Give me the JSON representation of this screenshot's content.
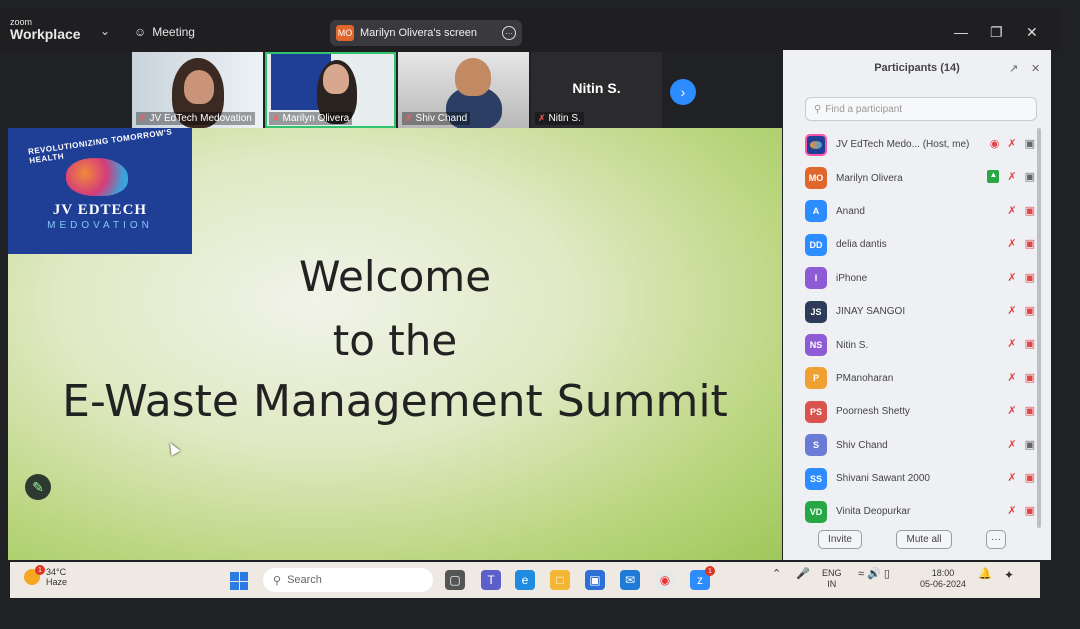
{
  "app": {
    "logo_small": "zoom",
    "logo_big": "Workplace",
    "meeting_label": "Meeting"
  },
  "share_pill": {
    "avatar": "MO",
    "label": "Marilyn Olivera's screen"
  },
  "thumbnails": [
    {
      "name": "JV EdTech Medovation"
    },
    {
      "name": "Marilyn Olivera"
    },
    {
      "name": "Shiv Chand"
    },
    {
      "name": "Nitin S.",
      "big_label": "Nitin S."
    }
  ],
  "slide": {
    "logo_arc": "REVOLUTIONIZING TOMORROW'S HEALTH",
    "logo_title": "JV EDTECH",
    "logo_sub": "MEDOVATION",
    "line1": "Welcome",
    "line2": "to the",
    "line3": "E-Waste Management Summit"
  },
  "participants": {
    "title": "Participants (14)",
    "search_placeholder": "Find a participant",
    "list": [
      {
        "initials": "",
        "name": "JV EdTech Medo... (Host, me)",
        "color": "#1f3e96"
      },
      {
        "initials": "MO",
        "name": "Marilyn Olivera",
        "color": "#e0662c"
      },
      {
        "initials": "A",
        "name": "Anand",
        "color": "#2d8cff"
      },
      {
        "initials": "DD",
        "name": "delia dantis",
        "color": "#2d8cff"
      },
      {
        "initials": "I",
        "name": "iPhone",
        "color": "#8e5bd6"
      },
      {
        "initials": "JS",
        "name": "JINAY SANGOI",
        "color": "#2d3a5a"
      },
      {
        "initials": "NS",
        "name": "Nitin S.",
        "color": "#8e5bd6"
      },
      {
        "initials": "P",
        "name": "PManoharan",
        "color": "#f0a030"
      },
      {
        "initials": "PS",
        "name": "Poornesh Shetty",
        "color": "#d9534f"
      },
      {
        "initials": "S",
        "name": "Shiv Chand",
        "color": "#6a7bd6"
      },
      {
        "initials": "SS",
        "name": "Shivani Sawant 2000",
        "color": "#2d8cff"
      },
      {
        "initials": "VD",
        "name": "Vinita Deopurkar",
        "color": "#28a745"
      }
    ],
    "invite_label": "Invite",
    "mute_all_label": "Mute all",
    "more_label": "···"
  },
  "taskbar": {
    "weather_temp": "34°C",
    "weather_desc": "Haze",
    "search_placeholder": "Search",
    "lang_top": "ENG",
    "lang_bottom": "IN",
    "time": "18:00",
    "date": "05-06-2024",
    "weather_badge": "1",
    "mail_badge": "1"
  }
}
